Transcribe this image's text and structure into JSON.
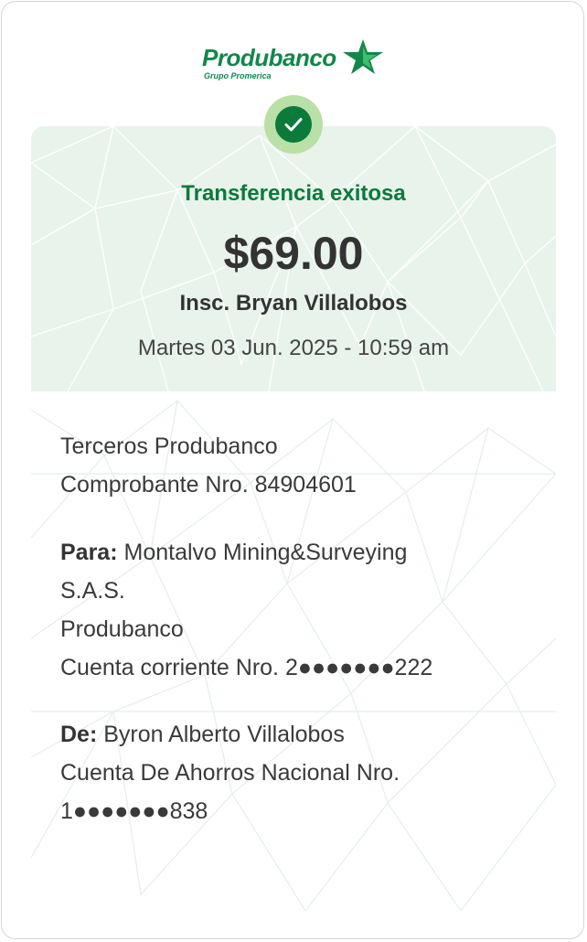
{
  "brand": {
    "name": "Produbanco",
    "tagline": "Grupo Promerica",
    "color": "#10884a"
  },
  "status": {
    "icon": "check-icon",
    "title": "Transferencia exitosa",
    "color": "#0b7a3b"
  },
  "amount": "$69.00",
  "beneficiary_name": "Insc. Bryan Villalobos",
  "datetime": "Martes 03 Jun. 2025 - 10:59 am",
  "details": {
    "type": "Terceros Produbanco",
    "receipt_number": "Comprobante Nro. 84904601"
  },
  "to": {
    "label": "Para:",
    "name_line1": "Montalvo Mining&Surveying",
    "name_line2": "S.A.S.",
    "bank": "Produbanco",
    "account": "Cuenta corriente Nro. 2●●●●●●●222"
  },
  "from": {
    "label": "De:",
    "name": "Byron Alberto Villalobos",
    "account_line1": "Cuenta De Ahorros Nacional Nro.",
    "account_line2": "1●●●●●●●838"
  }
}
